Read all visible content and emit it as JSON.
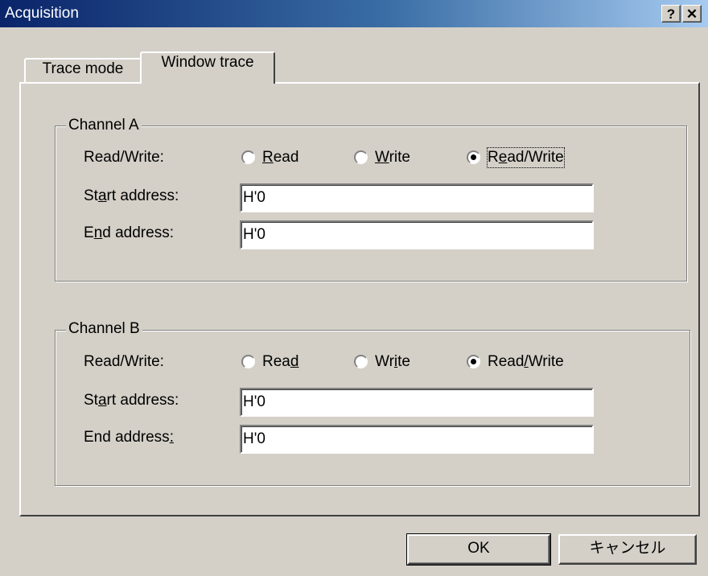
{
  "window": {
    "title": "Acquisition",
    "help_button": "?",
    "close_button": "✕"
  },
  "tabs": [
    {
      "label": "Trace mode",
      "active": false
    },
    {
      "label": "Window trace",
      "active": true
    }
  ],
  "channels": [
    {
      "legend": "Channel A",
      "rw_label": "Read/Write:",
      "options": [
        {
          "label": "Read",
          "selected": false
        },
        {
          "label": "Write",
          "selected": false
        },
        {
          "label": "Read/Write",
          "selected": true
        }
      ],
      "start_label": "Start address:",
      "start_value": "H'0",
      "end_label": "End address:",
      "end_value": "H'0"
    },
    {
      "legend": "Channel B",
      "rw_label": "Read/Write:",
      "options": [
        {
          "label": "Read",
          "selected": false
        },
        {
          "label": "Write",
          "selected": false
        },
        {
          "label": "Read/Write",
          "selected": true
        }
      ],
      "start_label": "Start address:",
      "start_value": "H'0",
      "end_label": "End address:",
      "end_value": "H'0"
    }
  ],
  "buttons": {
    "ok": "OK",
    "cancel": "キャンセル"
  }
}
